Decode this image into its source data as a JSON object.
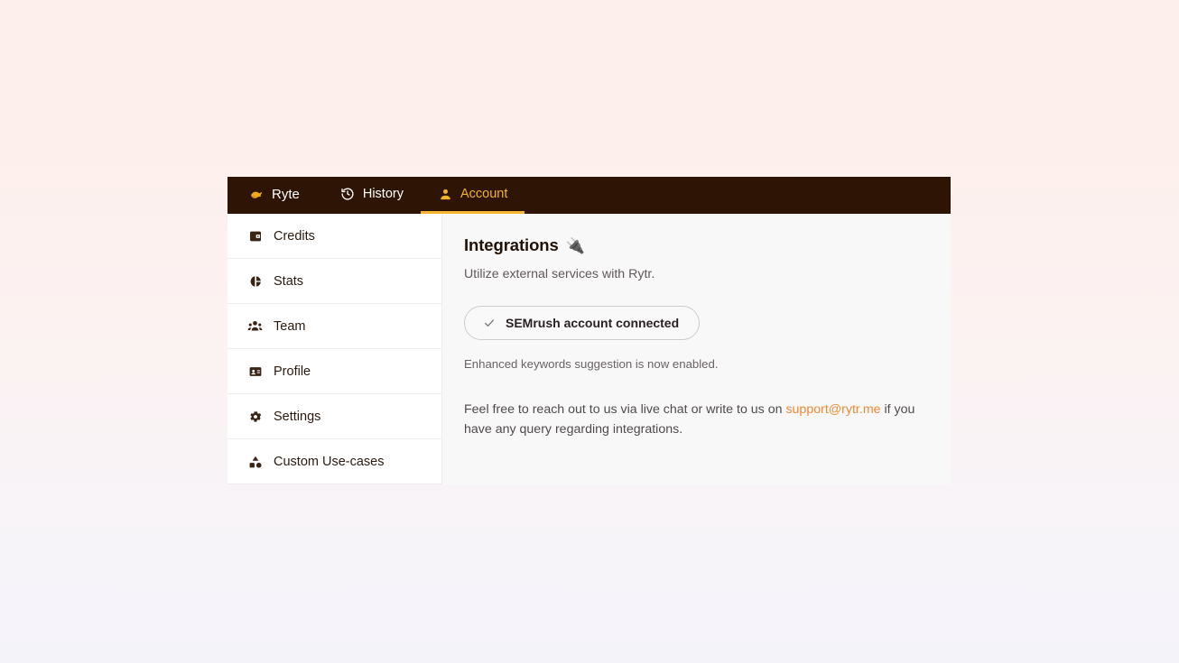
{
  "topnav": {
    "background_color": "#2e1405",
    "active_color": "#f0b429",
    "tabs": [
      {
        "label": "Ryte",
        "icon": "ryte-logo-icon",
        "active": false
      },
      {
        "label": "History",
        "icon": "history-clock-icon",
        "active": false
      },
      {
        "label": "Account",
        "icon": "user-person-icon",
        "active": true
      }
    ]
  },
  "sidebar": {
    "items": [
      {
        "label": "Credits",
        "icon": "wallet-icon"
      },
      {
        "label": "Stats",
        "icon": "pie-chart-icon"
      },
      {
        "label": "Team",
        "icon": "people-group-icon"
      },
      {
        "label": "Profile",
        "icon": "id-card-icon"
      },
      {
        "label": "Settings",
        "icon": "gear-icon"
      },
      {
        "label": "Custom Use-cases",
        "icon": "shapes-category-icon"
      }
    ]
  },
  "main": {
    "title": "Integrations",
    "title_emoji": "🔌",
    "subtitle": "Utilize external services with Rytr.",
    "integration": {
      "status_label": "SEMrush account connected",
      "check_icon": "check-icon",
      "note": "Enhanced keywords suggestion is now enabled."
    },
    "help": {
      "text_before": "Feel free to reach out to us via live chat or write to us on ",
      "email": "support@rytr.me",
      "text_after": " if you have any query regarding integrations.",
      "link_color": "#ef8a33"
    }
  }
}
